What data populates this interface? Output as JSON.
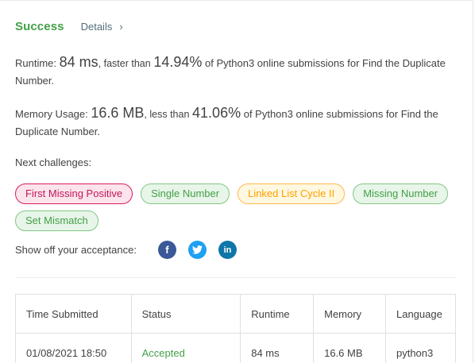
{
  "header": {
    "status": "Success",
    "details_label": "Details",
    "chevron": "›"
  },
  "runtime": {
    "label": "Runtime:",
    "value": "84 ms",
    "middle": ", faster than",
    "percent": "14.94%",
    "tail": "of Python3 online submissions for Find the Duplicate Number."
  },
  "memory": {
    "label": "Memory Usage:",
    "value": "16.6 MB",
    "middle": ", less than",
    "percent": "41.06%",
    "tail": "of Python3 online submissions for Find the Duplicate Number."
  },
  "next": {
    "label": "Next challenges:",
    "items": [
      {
        "label": "First Missing Positive",
        "difficulty": "hard"
      },
      {
        "label": "Single Number",
        "difficulty": "easy"
      },
      {
        "label": "Linked List Cycle II",
        "difficulty": "medium"
      },
      {
        "label": "Missing Number",
        "difficulty": "easy"
      },
      {
        "label": "Set Mismatch",
        "difficulty": "easy"
      }
    ]
  },
  "share": {
    "label": "Show off your acceptance:",
    "icons": [
      {
        "name": "facebook-icon",
        "glyph": "f"
      },
      {
        "name": "twitter-icon",
        "glyph": "t"
      },
      {
        "name": "linkedin-icon",
        "glyph": "in"
      }
    ]
  },
  "submissions": {
    "columns": [
      "Time Submitted",
      "Status",
      "Runtime",
      "Memory",
      "Language"
    ],
    "rows": [
      [
        "01/08/2021 18:50",
        "Accepted",
        "84 ms",
        "16.6 MB",
        "python3"
      ]
    ]
  },
  "colors": {
    "accent": "#43a047",
    "hard": "#d81b60",
    "medium": "#ffa000",
    "easy": "#43a047"
  }
}
